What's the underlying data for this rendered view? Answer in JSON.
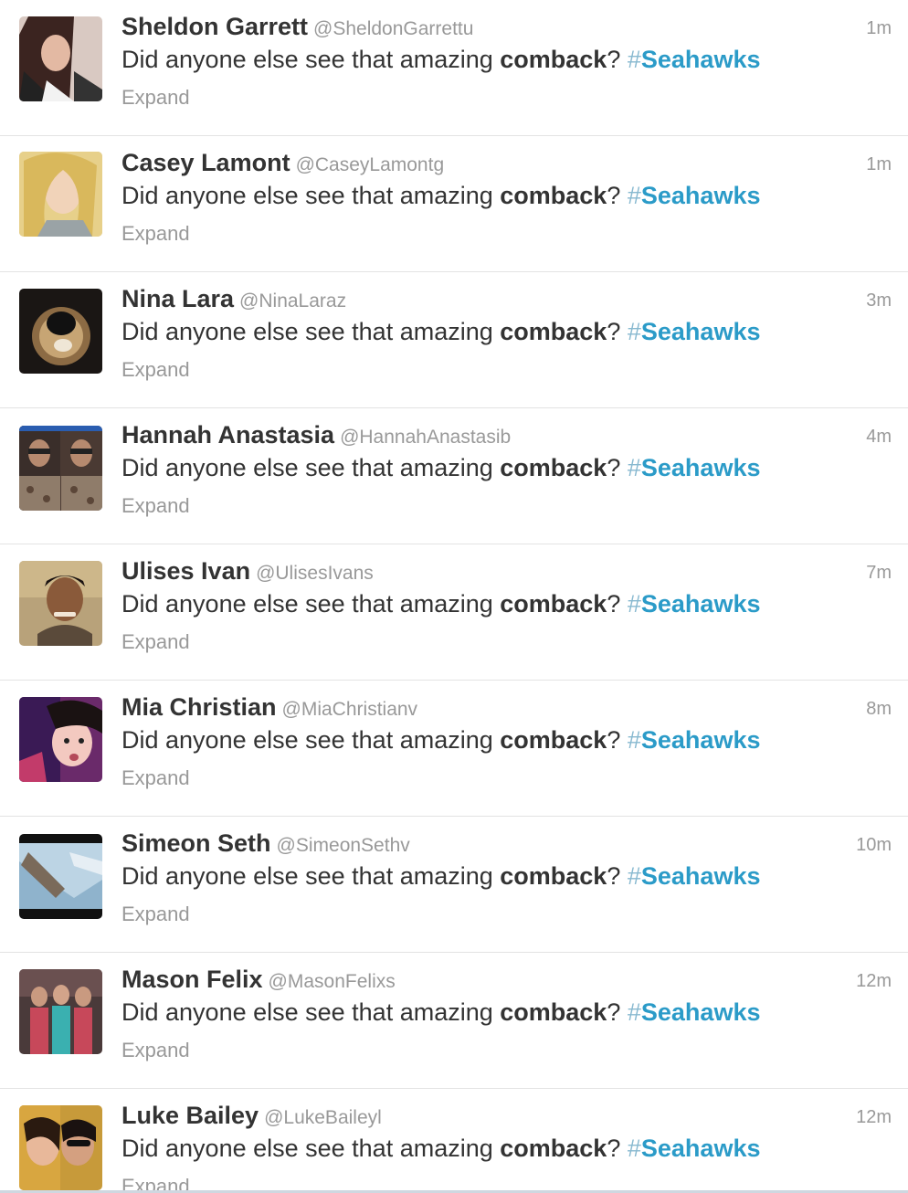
{
  "tweets": [
    {
      "name": "Sheldon Garrett",
      "handle": "@SheldonGarrettu",
      "time": "1m",
      "text_pre": "Did anyone else see that amazing ",
      "text_bold": "comback",
      "text_post": "? ",
      "hash_symbol": "#",
      "hash_word": "Seahawks",
      "expand": "Expand",
      "avatar_icon": "profile-photo-woman"
    },
    {
      "name": "Casey Lamont",
      "handle": "@CaseyLamontg",
      "time": "1m",
      "text_pre": "Did anyone else see that amazing ",
      "text_bold": "comback",
      "text_post": "? ",
      "hash_symbol": "#",
      "hash_word": "Seahawks",
      "expand": "Expand",
      "avatar_icon": "profile-photo-blonde"
    },
    {
      "name": "Nina Lara",
      "handle": "@NinaLaraz",
      "time": "3m",
      "text_pre": "Did anyone else see that amazing ",
      "text_bold": "comback",
      "text_post": "? ",
      "hash_symbol": "#",
      "hash_word": "Seahawks",
      "expand": "Expand",
      "avatar_icon": "profile-photo-dark"
    },
    {
      "name": "Hannah Anastasia",
      "handle": "@HannahAnastasib",
      "time": "4m",
      "text_pre": "Did anyone else see that amazing ",
      "text_bold": "comback",
      "text_post": "? ",
      "hash_symbol": "#",
      "hash_word": "Seahawks",
      "expand": "Expand",
      "avatar_icon": "profile-photo-mirror"
    },
    {
      "name": "Ulises Ivan",
      "handle": "@UlisesIvans",
      "time": "7m",
      "text_pre": "Did anyone else see that amazing ",
      "text_bold": "comback",
      "text_post": "? ",
      "hash_symbol": "#",
      "hash_word": "Seahawks",
      "expand": "Expand",
      "avatar_icon": "profile-photo-man"
    },
    {
      "name": "Mia Christian",
      "handle": "@MiaChristianv",
      "time": "8m",
      "text_pre": "Did anyone else see that amazing ",
      "text_bold": "comback",
      "text_post": "? ",
      "hash_symbol": "#",
      "hash_word": "Seahawks",
      "expand": "Expand",
      "avatar_icon": "profile-photo-selfie"
    },
    {
      "name": "Simeon Seth",
      "handle": "@SimeonSethv",
      "time": "10m",
      "text_pre": "Did anyone else see that amazing ",
      "text_bold": "comback",
      "text_post": "? ",
      "hash_symbol": "#",
      "hash_word": "Seahawks",
      "expand": "Expand",
      "avatar_icon": "profile-photo-blue"
    },
    {
      "name": "Mason Felix",
      "handle": "@MasonFelixs",
      "time": "12m",
      "text_pre": "Did anyone else see that amazing ",
      "text_bold": "comback",
      "text_post": "? ",
      "hash_symbol": "#",
      "hash_word": "Seahawks",
      "expand": "Expand",
      "avatar_icon": "profile-photo-group"
    },
    {
      "name": "Luke Bailey",
      "handle": "@LukeBaileyl",
      "time": "12m",
      "text_pre": "Did anyone else see that amazing ",
      "text_bold": "comback",
      "text_post": "? ",
      "hash_symbol": "#",
      "hash_word": "Seahawks",
      "expand": "Expand",
      "avatar_icon": "profile-photo-couple"
    }
  ],
  "colors": {
    "hashtag": "#2b9bc8",
    "name": "#333333",
    "meta": "#999999"
  }
}
